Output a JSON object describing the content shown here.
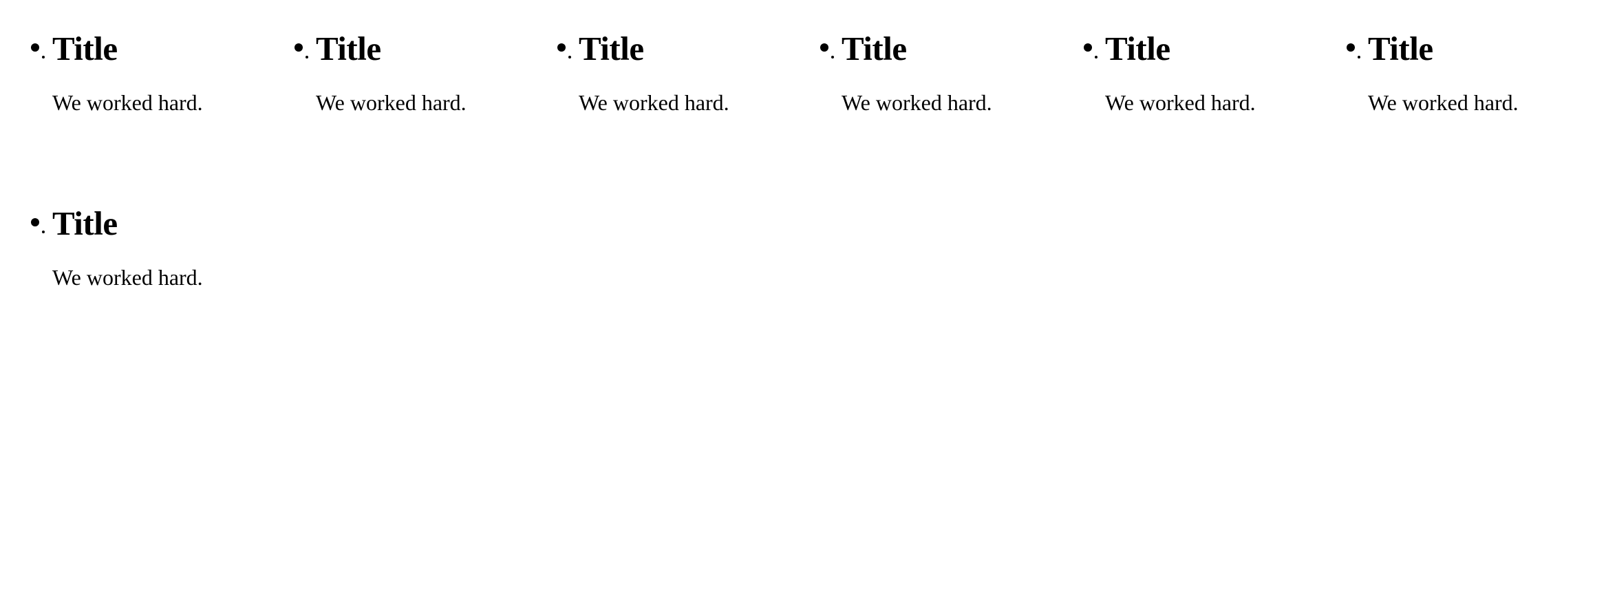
{
  "cards": [
    {
      "title": "Title",
      "body": "We worked hard."
    },
    {
      "title": "Title",
      "body": "We worked hard."
    },
    {
      "title": "Title",
      "body": "We worked hard."
    },
    {
      "title": "Title",
      "body": "We worked hard."
    },
    {
      "title": "Title",
      "body": "We worked hard."
    },
    {
      "title": "Title",
      "body": "We worked hard."
    },
    {
      "title": "Title",
      "body": "We worked hard."
    }
  ]
}
